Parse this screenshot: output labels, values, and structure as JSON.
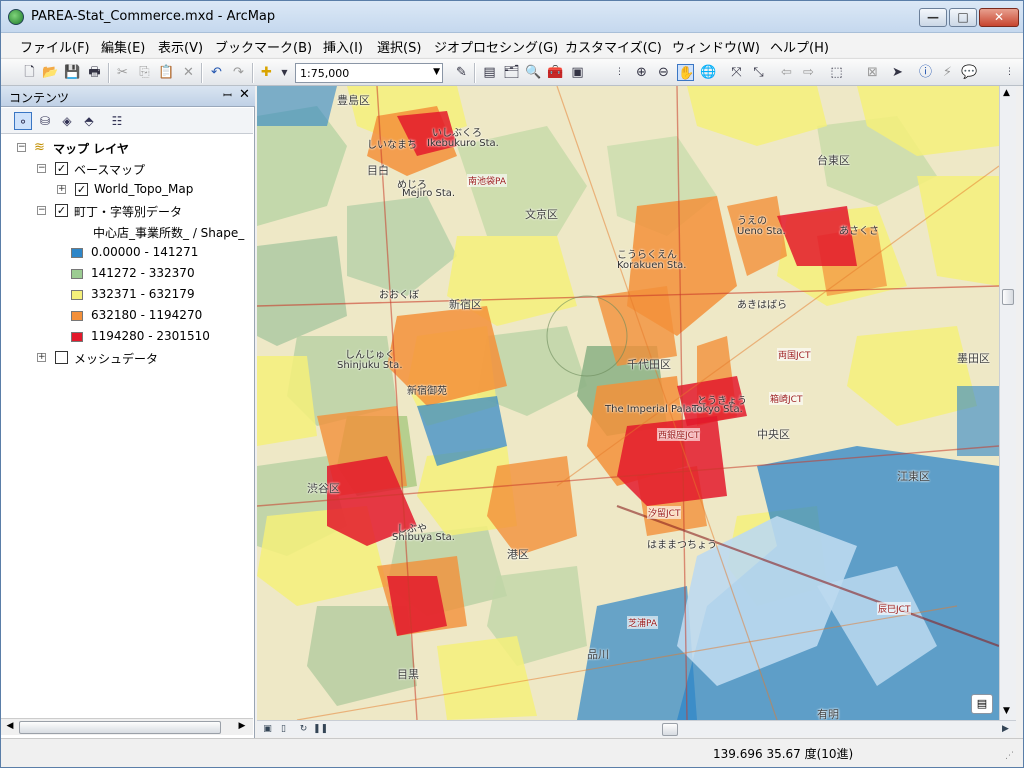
{
  "window": {
    "title": "PAREA-Stat_Commerce.mxd - ArcMap",
    "min_label": "—",
    "max_label": "□",
    "close_label": "✕"
  },
  "menu": {
    "items": [
      "ファイル(F)",
      "編集(E)",
      "表示(V)",
      "ブックマーク(B)",
      "挿入(I)",
      "選択(S)",
      "ジオプロセシング(G)",
      "カスタマイズ(C)",
      "ウィンドウ(W)",
      "ヘルプ(H)"
    ]
  },
  "toolbar": {
    "scale_value": "1:75,000",
    "icons": [
      "new-icon",
      "open-icon",
      "save-icon",
      "print-icon",
      "cut-icon",
      "copy-icon",
      "paste-icon",
      "delete-icon",
      "undo-icon",
      "redo-icon",
      "add-data-icon",
      "editor-icon",
      "table-icon",
      "catalog-icon",
      "search-icon",
      "arctoolbox-icon",
      "python-icon",
      "zoom-in-icon",
      "zoom-out-icon",
      "pan-icon",
      "full-extent-icon",
      "fixed-zoom-in-icon",
      "fixed-zoom-out-icon",
      "back-icon",
      "forward-icon",
      "select-features-icon",
      "clear-selection-icon",
      "select-elements-icon",
      "identify-icon",
      "hyperlink-icon",
      "html-popup-icon"
    ]
  },
  "toc": {
    "title": "コンテンツ",
    "pin": "ꟷ",
    "close": "✕",
    "root": "マップ レイヤ",
    "basemap_group": "ベースマップ",
    "basemap_layer": "World_Topo_Map",
    "data_layer": "町丁・字等別データ",
    "field_label": "中心店_事業所数_ / Shape_",
    "classes": [
      {
        "label": "0.00000 - 141271",
        "color": "#2e86c8"
      },
      {
        "label": "141272 - 332370",
        "color": "#9ccc92"
      },
      {
        "label": "332371 - 632179",
        "color": "#f5f07a"
      },
      {
        "label": "632180 - 1194270",
        "color": "#f3903a"
      },
      {
        "label": "1194280 - 2301510",
        "color": "#e3192b"
      }
    ],
    "mesh_layer": "メッシュデータ"
  },
  "map": {
    "labels": [
      "豊島区",
      "いしぶくろ",
      "Ikebukuro Sta.",
      "しいなまち",
      "めじろ",
      "目白",
      "Mejiro Sta.",
      "南池袋PA",
      "文京区",
      "こうらくえん",
      "Korakuen Sta.",
      "台東区",
      "うえの",
      "Ueno Sta.",
      "あさくさ",
      "新宿区",
      "しんじゅく",
      "Shinjuku Sta.",
      "新宿御苑",
      "千代田区",
      "The Imperial Palace",
      "とうきょう",
      "Tokyo Sta.",
      "西銀座JCT",
      "渋谷区",
      "しぶや",
      "Shibuya Sta.",
      "港区",
      "中央区",
      "江東区",
      "墨田区",
      "目黒",
      "品川",
      "芝浦PA",
      "辰巳JCT",
      "有明",
      "おおくぼ",
      "あきはばら",
      "両国JCT",
      "箱崎JCT",
      "はままつちょう",
      "汐留JCT"
    ]
  },
  "status": {
    "coords": "139.696  35.67 度(10進)"
  }
}
